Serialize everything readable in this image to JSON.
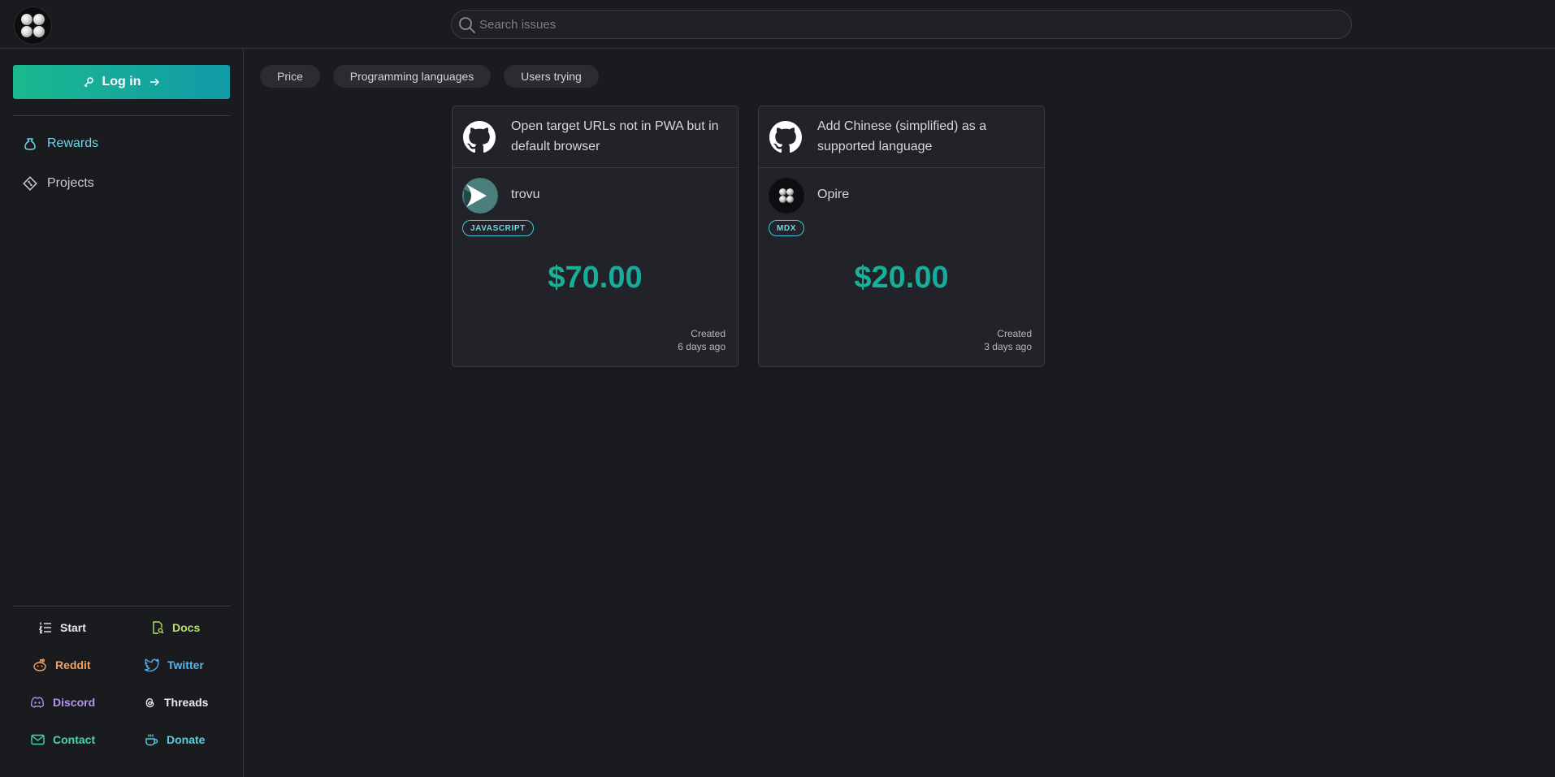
{
  "header": {
    "logo_icon": "opire-logo-icon",
    "search": {
      "placeholder": "Search issues",
      "value": ""
    }
  },
  "sidebar": {
    "login_label": "Log in",
    "nav": [
      {
        "label": "Rewards",
        "icon": "money-bag-icon",
        "active": true
      },
      {
        "label": "Projects",
        "icon": "diamond-git-icon",
        "active": false
      }
    ],
    "footer_links": [
      {
        "label": "Start",
        "icon": "list-icon",
        "color": "#e8e9ec"
      },
      {
        "label": "Docs",
        "icon": "document-search-icon",
        "color": "#b3e46c"
      },
      {
        "label": "Reddit",
        "icon": "reddit-icon",
        "color": "#f4a261"
      },
      {
        "label": "Twitter",
        "icon": "twitter-icon",
        "color": "#5ab4f0"
      },
      {
        "label": "Discord",
        "icon": "discord-icon",
        "color": "#b593f3"
      },
      {
        "label": "Threads",
        "icon": "threads-icon",
        "color": "#e8e9ec"
      },
      {
        "label": "Contact",
        "icon": "mail-icon",
        "color": "#3fd6b0"
      },
      {
        "label": "Donate",
        "icon": "coffee-icon",
        "color": "#54cfe3"
      }
    ]
  },
  "filters": [
    "Price",
    "Programming languages",
    "Users trying"
  ],
  "cards": [
    {
      "title": "Open target URLs not in PWA but in default browser",
      "project": "trovu",
      "language": "JAVASCRIPT",
      "price": "$70.00",
      "created_label": "Created",
      "created_ago": "6 days ago"
    },
    {
      "title": "Add Chinese (simplified) as a supported language",
      "project": "Opire",
      "language": "MDX",
      "price": "$20.00",
      "created_label": "Created",
      "created_ago": "3 days ago"
    }
  ],
  "colors": {
    "background": "#1a1b1f",
    "accent_gradient_start": "#1bb98e",
    "accent_gradient_end": "#119aa8",
    "active_nav": "#6cd6e6"
  }
}
